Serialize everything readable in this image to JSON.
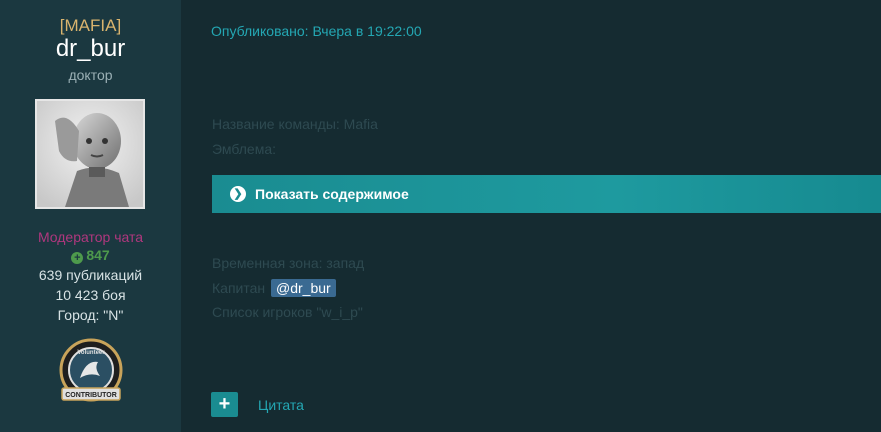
{
  "author": {
    "tag": "[MAFIA]",
    "name": "dr_bur",
    "title": "доктор",
    "group": "Модератор чата",
    "reputation": "847",
    "posts": "639 публикаций",
    "battles": "10 423 боя",
    "city": "Город: \"N\"",
    "badge_text_top": "Volunteer",
    "badge_text_bottom": "CONTRIBUTOR"
  },
  "post": {
    "published": "Опубликовано: Вчера в 19:22:00",
    "team_name": "Название команды: Mafia",
    "emblem": "Эмблема:",
    "spoiler_label": "Показать содержимое",
    "timezone": "Временная зона: запад",
    "captain_label": "Капитан",
    "captain_mention": "@dr_bur",
    "players": "Список игроков \"w_i_p\""
  },
  "actions": {
    "quote_label": "Цитата"
  },
  "colors": {
    "sidebar_bg": "#1b3840",
    "page_bg": "#152b31",
    "accent": "#1a8c91",
    "link": "#24a7b3",
    "group": "#b0377e",
    "rep": "#4e9a4c",
    "tag": "#d9b46e",
    "mention_bg": "#3a6a92"
  }
}
